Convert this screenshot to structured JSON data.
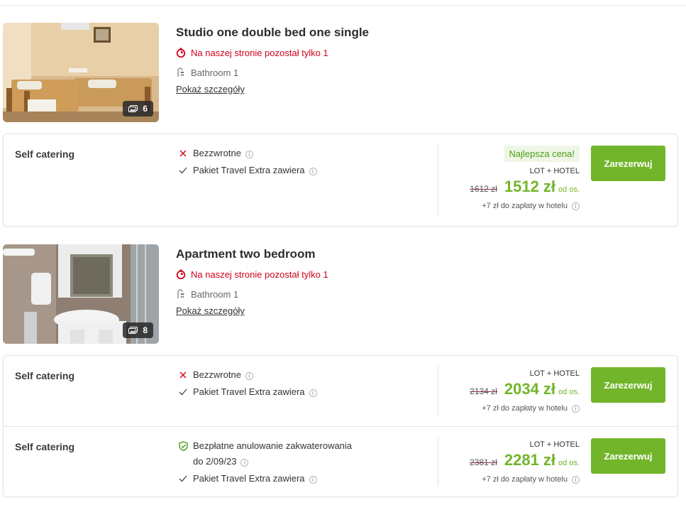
{
  "rooms": [
    {
      "title": "Studio one double bed one single",
      "availability": "Na naszej stronie pozostał tylko 1",
      "bathroom": "Bathroom 1",
      "details_link": "Pokaż szczegóły",
      "photo_count": "6",
      "offers": [
        {
          "board": "Self catering",
          "conditions": [
            {
              "icon": "x-icon",
              "text": "Bezzwrotne"
            },
            {
              "icon": "check-icon",
              "text": "Pakiet Travel Extra zawiera"
            }
          ],
          "badge": "Najlepsza cena!",
          "package": "LOT + HOTEL",
          "old_price": "1612 zł",
          "price": "1512 zł",
          "per_person": "od os.",
          "extra_fee": "+7 zł do zapłaty w hotelu",
          "button": "Zarezerwuj"
        }
      ]
    },
    {
      "title": "Apartment two bedroom",
      "availability": "Na naszej stronie pozostał tylko 1",
      "bathroom": "Bathroom 1",
      "details_link": "Pokaż szczegóły",
      "photo_count": "8",
      "offers": [
        {
          "board": "Self catering",
          "conditions": [
            {
              "icon": "x-icon",
              "text": "Bezzwrotne"
            },
            {
              "icon": "check-icon",
              "text": "Pakiet Travel Extra zawiera"
            }
          ],
          "package": "LOT + HOTEL",
          "old_price": "2134 zł",
          "price": "2034 zł",
          "per_person": "od os.",
          "extra_fee": "+7 zł do zapłaty w hotelu",
          "button": "Zarezerwuj"
        },
        {
          "board": "Self catering",
          "conditions": [
            {
              "icon": "shield-check-icon",
              "text": "Bezpłatne anulowanie zakwaterowania",
              "text2": "do 2/09/23"
            },
            {
              "icon": "check-icon",
              "text": "Pakiet Travel Extra zawiera"
            }
          ],
          "package": "LOT + HOTEL",
          "old_price": "2381 zł",
          "price": "2281 zł",
          "per_person": "od os.",
          "extra_fee": "+7 zł do zapłaty w hotelu",
          "button": "Zarezerwuj"
        }
      ]
    }
  ],
  "colors": {
    "accent_green": "#72b52a",
    "alert_red": "#d0021b",
    "best_bg": "#eef7e6"
  }
}
